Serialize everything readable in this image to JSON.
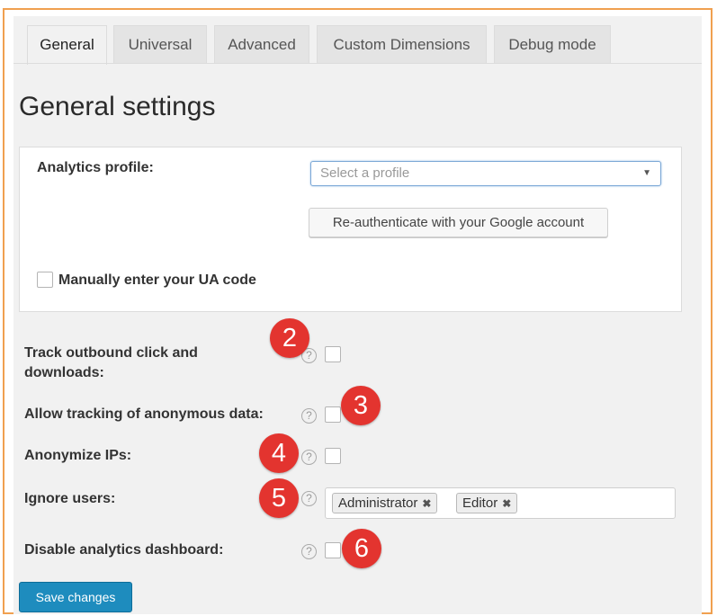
{
  "tabs": [
    {
      "label": "General",
      "active": true
    },
    {
      "label": "Universal"
    },
    {
      "label": "Advanced"
    },
    {
      "label": "Custom Dimensions"
    },
    {
      "label": "Debug mode"
    }
  ],
  "page_title": "General settings",
  "profile": {
    "label": "Analytics profile:",
    "select_placeholder": "Select a profile",
    "reauth_button": "Re-authenticate with your Google account",
    "manual_ua_label": "Manually enter your UA code"
  },
  "settings": {
    "track_outbound": {
      "label_line1": "Track outbound click and",
      "label_line2": "downloads:",
      "marker": "2"
    },
    "anonymous_data": {
      "label": "Allow tracking of anonymous data:",
      "marker": "3"
    },
    "anonymize_ips": {
      "label": "Anonymize IPs:",
      "marker": "4"
    },
    "ignore_users": {
      "label": "Ignore users:",
      "marker": "5",
      "tags": [
        "Administrator",
        "Editor"
      ]
    },
    "disable_dashboard": {
      "label": "Disable analytics dashboard:",
      "marker": "6"
    }
  },
  "help_glyph": "?",
  "remove_glyph": "✖",
  "select_arrow": "▼",
  "save_button": "Save changes",
  "colors": {
    "frame": "#f0a050",
    "marker": "#e3342f",
    "primary": "#1e8cbe"
  }
}
